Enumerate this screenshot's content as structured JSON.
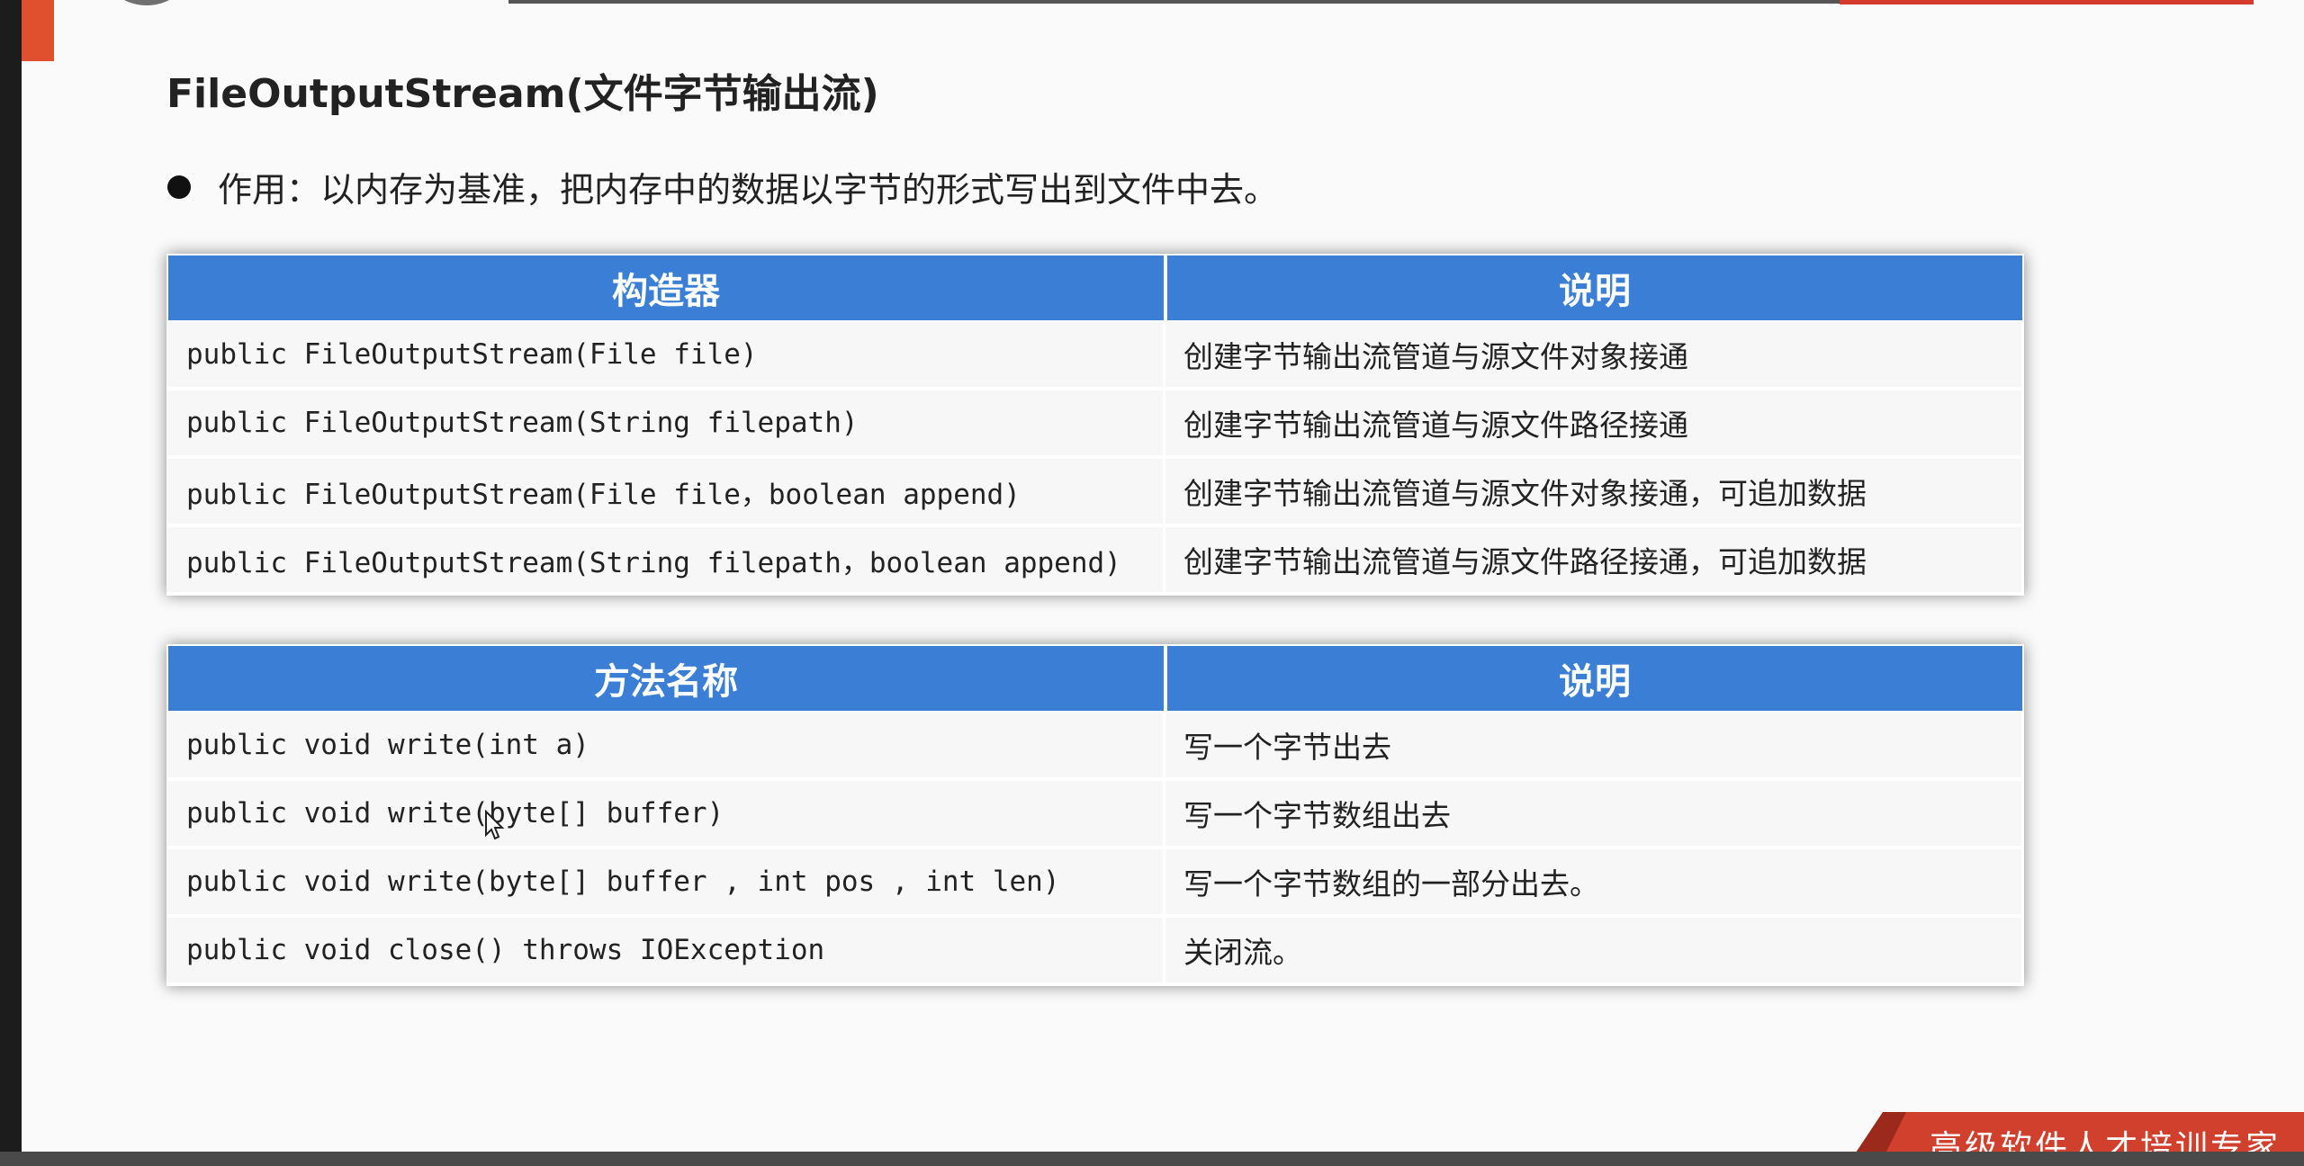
{
  "title": "FileOutputStream(文件字节输出流)",
  "bullet": "作用：以内存为基准，把内存中的数据以字节的形式写出到文件中去。",
  "constructors_table": {
    "headers": [
      "构造器",
      "说明"
    ],
    "rows": [
      {
        "signature": "public FileOutputStream(File file)",
        "description": "创建字节输出流管道与源文件对象接通"
      },
      {
        "signature": "public FileOutputStream(String filepath)",
        "description": "创建字节输出流管道与源文件路径接通"
      },
      {
        "signature": "public FileOutputStream(File file，boolean append)",
        "description": "创建字节输出流管道与源文件对象接通，可追加数据"
      },
      {
        "signature": "public FileOutputStream(String filepath，boolean append)",
        "description": "创建字节输出流管道与源文件路径接通，可追加数据"
      }
    ]
  },
  "methods_table": {
    "headers": [
      "方法名称",
      "说明"
    ],
    "rows": [
      {
        "signature": "public void write(int a)",
        "description": "写一个字节出去"
      },
      {
        "signature": "public void write(byte[] buffer)",
        "description": "写一个字节数组出去"
      },
      {
        "signature": "public void write(byte[] buffer , int pos , int len)",
        "description": "写一个字节数组的一部分出去。"
      },
      {
        "signature": "public void close() throws IOException",
        "description": "关闭流。"
      }
    ]
  },
  "brand": "高级软件人才培训专家",
  "colors": {
    "header_blue": "#3a7fd5",
    "accent_red": "#d0402c",
    "text": "#222222",
    "slide_bg": "#fafafa"
  }
}
